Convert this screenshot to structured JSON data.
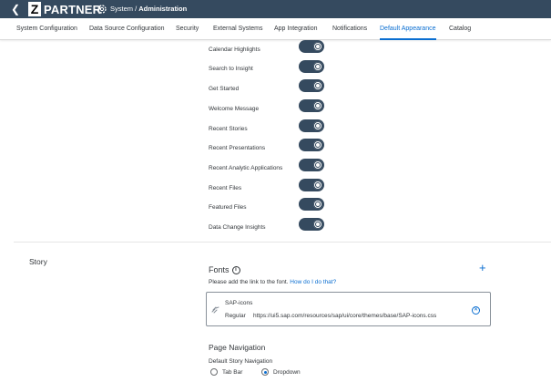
{
  "shell": {
    "logo_letter": "Z",
    "logo_text": "PARTNER",
    "crumb_path": "System / ",
    "crumb_current": "Administration",
    "back_icon": "chevron-left-icon",
    "settings_icon": "gear-icon"
  },
  "tabs": [
    {
      "label": "System Configuration",
      "active": false
    },
    {
      "label": "Data Source Configuration",
      "active": false
    },
    {
      "label": "Security",
      "active": false
    },
    {
      "label": "External Systems",
      "active": false
    },
    {
      "label": "App Integration",
      "active": false
    },
    {
      "label": "Notifications",
      "active": false
    },
    {
      "label": "Default Appearance",
      "active": true
    },
    {
      "label": "Catalog",
      "active": false
    }
  ],
  "toggles": [
    {
      "label": "Calendar Highlights",
      "on": true
    },
    {
      "label": "Search to Insight",
      "on": true
    },
    {
      "label": "Get Started",
      "on": true
    },
    {
      "label": "Welcome Message",
      "on": true
    },
    {
      "label": "Recent Stories",
      "on": true
    },
    {
      "label": "Recent Presentations",
      "on": true
    },
    {
      "label": "Recent Analytic Applications",
      "on": true
    },
    {
      "label": "Recent Files",
      "on": true
    },
    {
      "label": "Featured Files",
      "on": true
    },
    {
      "label": "Data Change Insights",
      "on": true
    }
  ],
  "story": {
    "section_title": "Story",
    "fonts": {
      "title": "Fonts",
      "description": "Please add the link to the font. ",
      "help_link": "How do I do that?",
      "add_icon": "plus-icon",
      "items": [
        {
          "name": "SAP-icons",
          "style": "Regular",
          "url": "https://ui5.sap.com/resources/sap/ui/core/themes/base/SAP-icons.css"
        }
      ]
    },
    "page_navigation": {
      "title": "Page Navigation",
      "subtitle": "Default Story Navigation",
      "options": [
        {
          "label": "Tab Bar",
          "selected": false
        },
        {
          "label": "Dropdown",
          "selected": true
        }
      ]
    }
  },
  "colors": {
    "shell_bg": "#354a5f",
    "accent": "#0a6ed1",
    "toggle_on": "#354a5f"
  }
}
